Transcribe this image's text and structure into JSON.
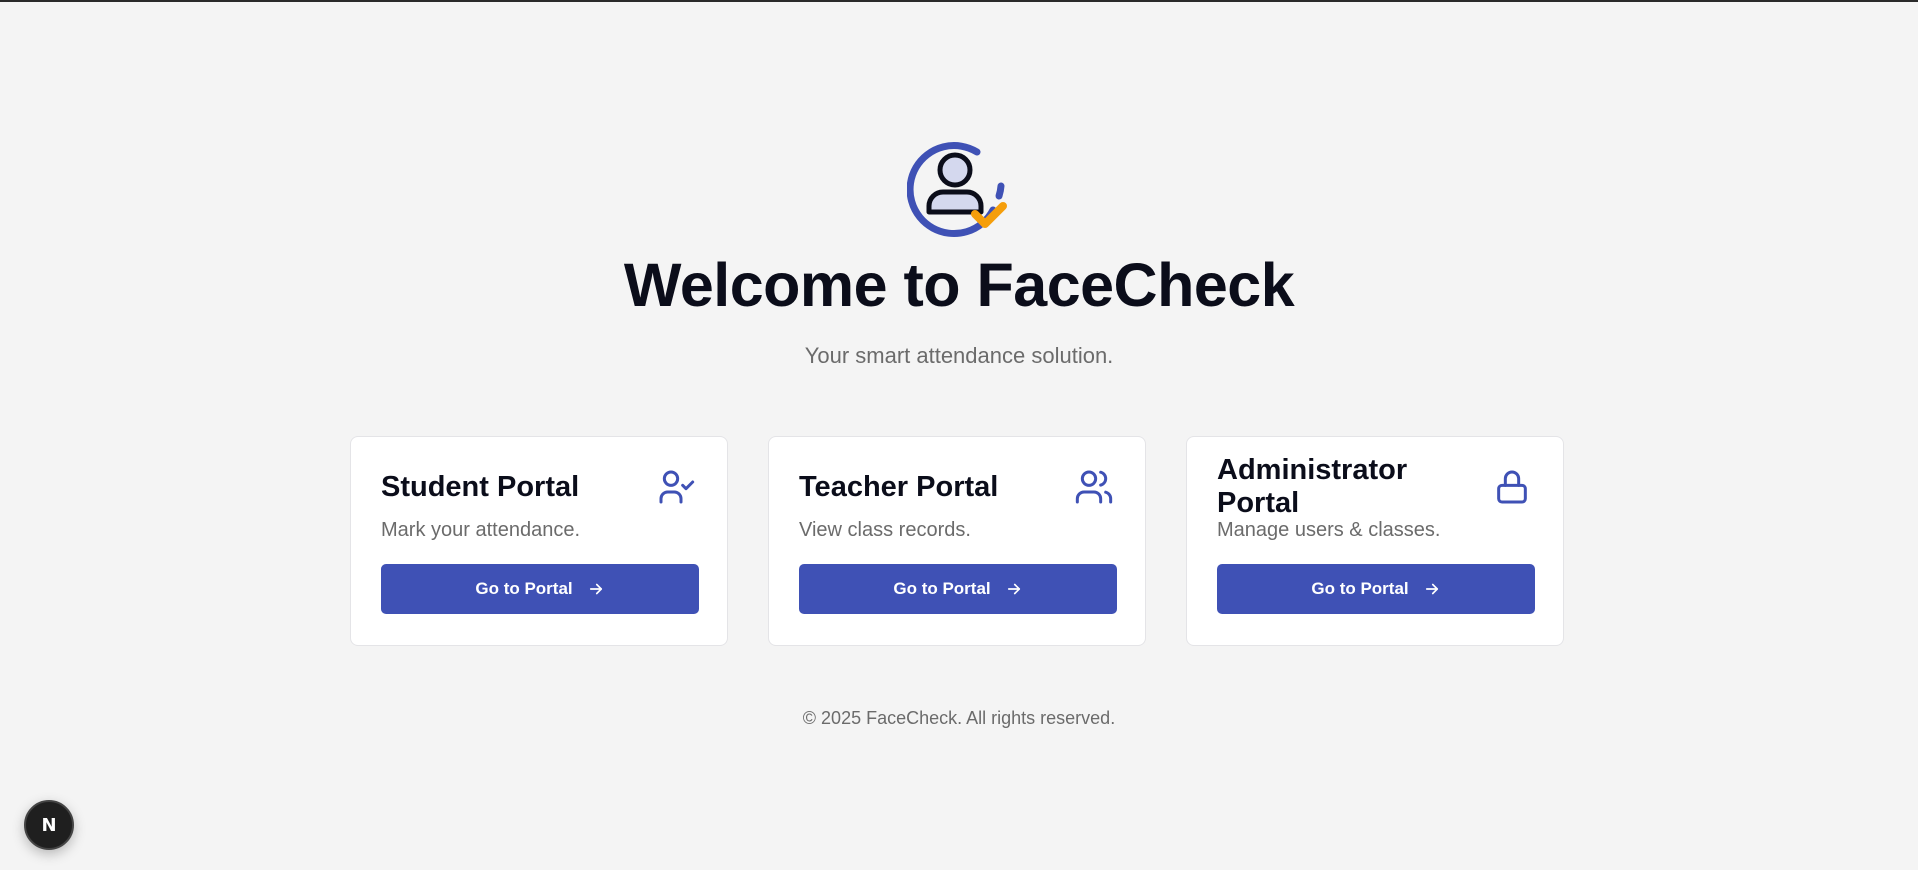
{
  "hero": {
    "logo_icon": "user-check-logo-icon",
    "title": "Welcome to FaceCheck",
    "subtitle": "Your smart attendance solution."
  },
  "portals": [
    {
      "title": "Student Portal",
      "description": "Mark your attendance.",
      "button_label": "Go to Portal",
      "icon": "user-check-icon"
    },
    {
      "title": "Teacher Portal",
      "description": "View class records.",
      "button_label": "Go to Portal",
      "icon": "users-icon"
    },
    {
      "title": "Administrator Portal",
      "description": "Manage users & classes.",
      "button_label": "Go to Portal",
      "icon": "lock-icon"
    }
  ],
  "footer": {
    "copyright": "© 2025 FaceCheck. All rights reserved."
  },
  "dev_badge": {
    "label": "N"
  },
  "colors": {
    "accent": "#3f51b5",
    "check": "#f59e0b",
    "background": "#f4f4f4"
  }
}
